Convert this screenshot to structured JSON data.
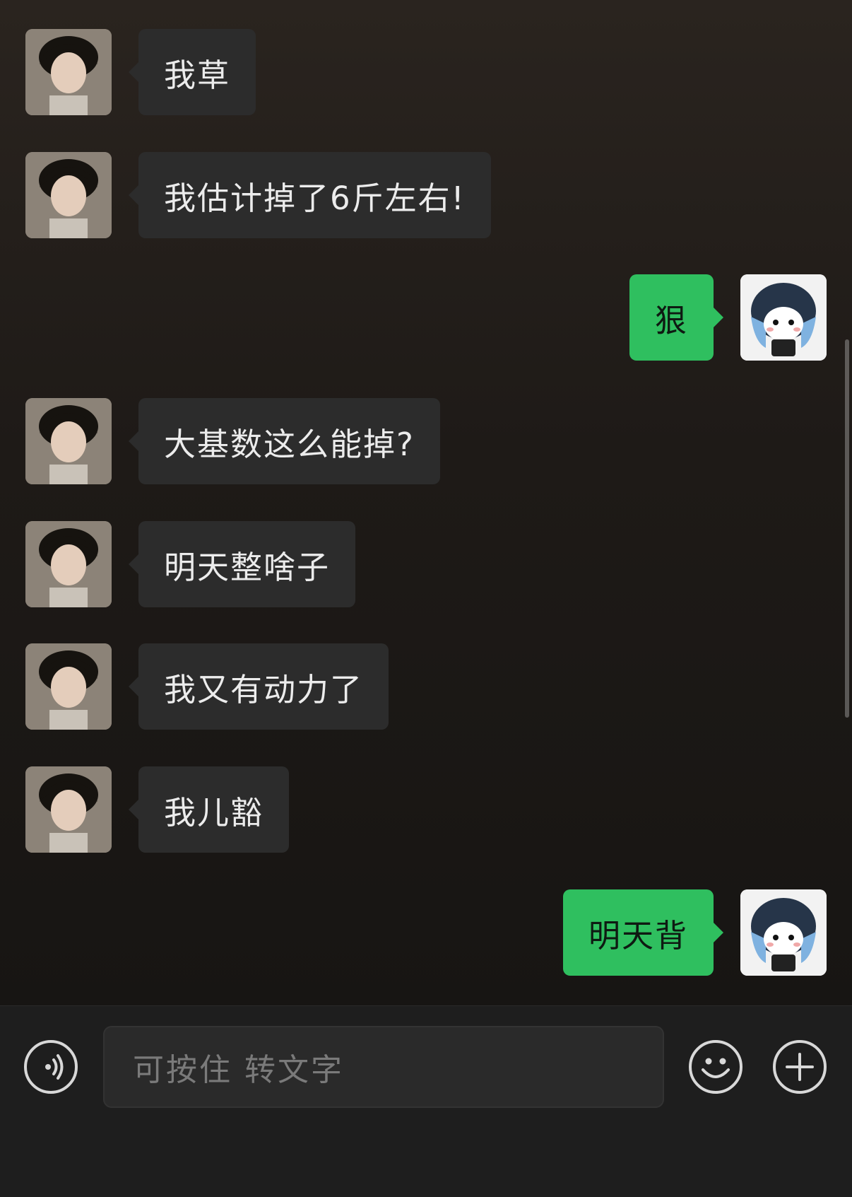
{
  "messages": [
    {
      "from": "friend",
      "text": "我草"
    },
    {
      "from": "friend",
      "text": "我估计掉了6斤左右!"
    },
    {
      "from": "me",
      "text": "狠"
    },
    {
      "from": "friend",
      "text": "大基数这么能掉?"
    },
    {
      "from": "friend",
      "text": "明天整啥子"
    },
    {
      "from": "friend",
      "text": "我又有动力了"
    },
    {
      "from": "friend",
      "text": "我儿豁"
    },
    {
      "from": "me",
      "text": "明天背"
    }
  ],
  "input": {
    "placeholder": "可按住 转文字"
  },
  "icons": {
    "voice": "voice-input-icon",
    "emoji": "emoji-icon",
    "more": "plus-icon"
  },
  "colors": {
    "outgoing_bubble": "#2fbf5f",
    "incoming_bubble": "#2c2c2c",
    "input_bar": "#1e1e1e"
  }
}
